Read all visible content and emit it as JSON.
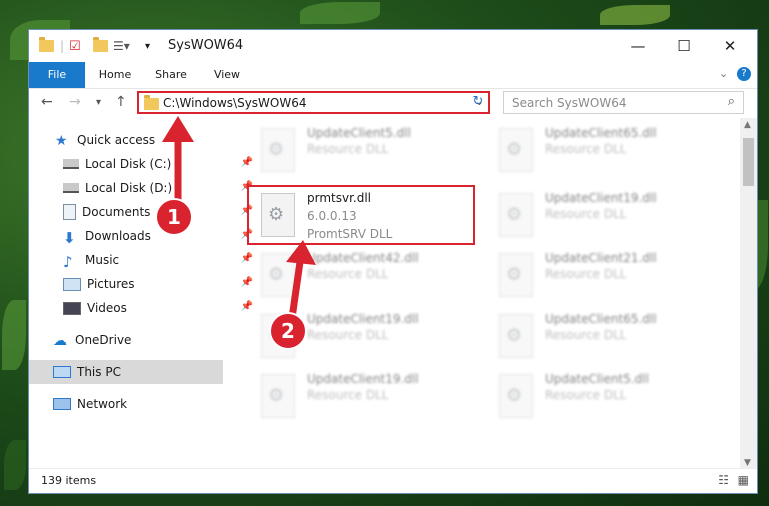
{
  "window": {
    "title": "SysWOW64"
  },
  "ribbon": {
    "tabs": [
      {
        "label": "File"
      },
      {
        "label": "Home"
      },
      {
        "label": "Share"
      },
      {
        "label": "View"
      }
    ]
  },
  "address": {
    "path": "C:\\Windows\\SysWOW64"
  },
  "search": {
    "placeholder": "Search SysWOW64"
  },
  "sidebar": {
    "items": [
      {
        "label": "Quick access"
      },
      {
        "label": "Local Disk (C:)"
      },
      {
        "label": "Local Disk (D:)"
      },
      {
        "label": "Documents"
      },
      {
        "label": "Downloads"
      },
      {
        "label": "Music"
      },
      {
        "label": "Pictures"
      },
      {
        "label": "Videos"
      },
      {
        "label": "OneDrive"
      },
      {
        "label": "This PC"
      },
      {
        "label": "Network"
      }
    ]
  },
  "files": [
    {
      "name": "UpdateClient5.dll",
      "type": "Resource DLL"
    },
    {
      "name": "UpdateClient65.dll",
      "type": "Resource DLL"
    },
    {
      "name": "prmtsvr.dll",
      "version": "6.0.0.13",
      "type": "PromtSRV DLL"
    },
    {
      "name": "UpdateClient19.dll",
      "type": "Resource DLL"
    },
    {
      "name": "UpdateClient42.dll",
      "type": "Resource DLL"
    },
    {
      "name": "UpdateClient21.dll",
      "type": "Resource DLL"
    },
    {
      "name": "UpdateClient19.dll",
      "type": "Resource DLL"
    },
    {
      "name": "UpdateClient65.dll",
      "type": "Resource DLL"
    },
    {
      "name": "UpdateClient19.dll",
      "type": "Resource DLL"
    },
    {
      "name": "UpdateClient5.dll",
      "type": "Resource DLL"
    }
  ],
  "status": {
    "count": "139 items"
  },
  "annotations": {
    "step1": "1",
    "step2": "2"
  },
  "colors": {
    "accent": "#1979ca",
    "highlight": "#d9232e"
  }
}
